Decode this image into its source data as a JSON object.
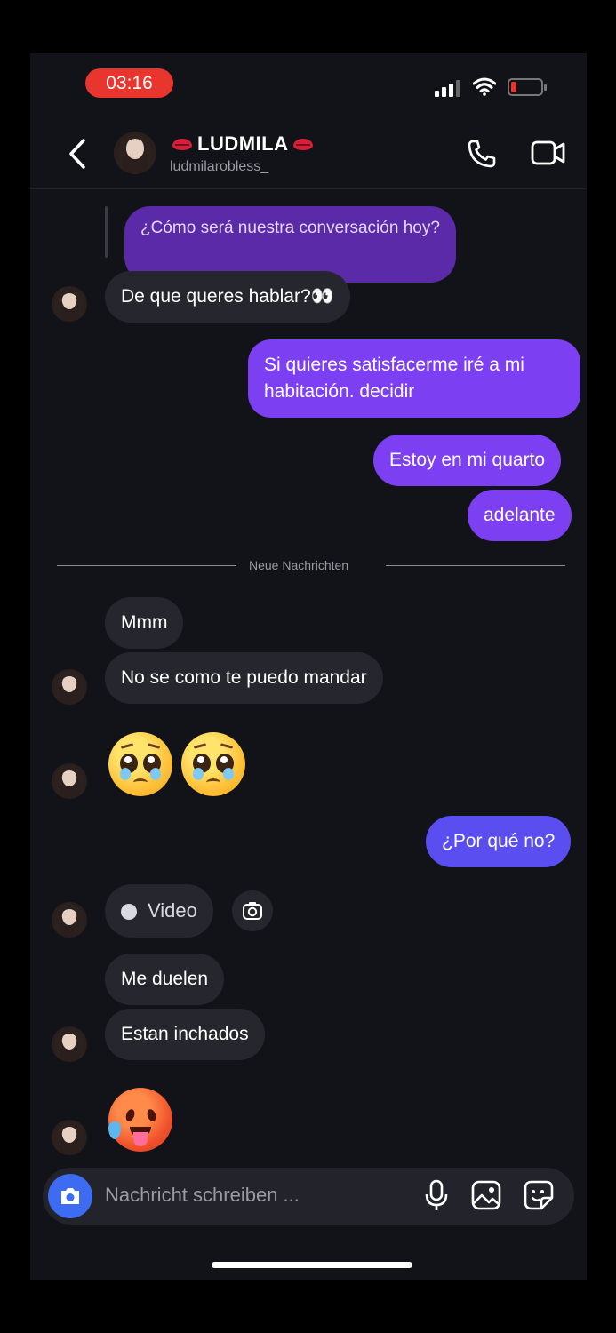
{
  "status_bar": {
    "time": "03:16",
    "battery_color": "#e8352e"
  },
  "header": {
    "name": "LUDMILA",
    "username": "ludmilarobless_",
    "decor_icon": "lips-kiss-icon",
    "back_icon": "chevron-left-icon",
    "call_icon": "phone-icon",
    "video_call_icon": "video-camera-icon"
  },
  "reply_preview": "¿Cómo será nuestra conversación hoy?",
  "messages": {
    "m1": "De que queres hablar?👀",
    "m2_line1": "Si quieres satisfacerme iré a mi",
    "m2_line2": "habitación. decidir",
    "m3": "Estoy en mi quarto",
    "m4": "adelante",
    "m5": "Mmm",
    "m6": "No se como te puedo mandar",
    "m7_emojis": "🥺🥺",
    "m8": "¿Por qué no?",
    "m9_video_label": "Video",
    "m10": "Me duelen",
    "m11": "Estan inchados",
    "m12_emoji": "🥵"
  },
  "divider": {
    "label": "Neue Nachrichten"
  },
  "composer": {
    "placeholder": "Nachricht schreiben ..."
  },
  "colors": {
    "outgoing_purple": "#7c3ff2",
    "outgoing_blue": "#5a4ef0",
    "incoming": "#26272e",
    "background": "#121318",
    "camera_button": "#3d6cf2"
  }
}
